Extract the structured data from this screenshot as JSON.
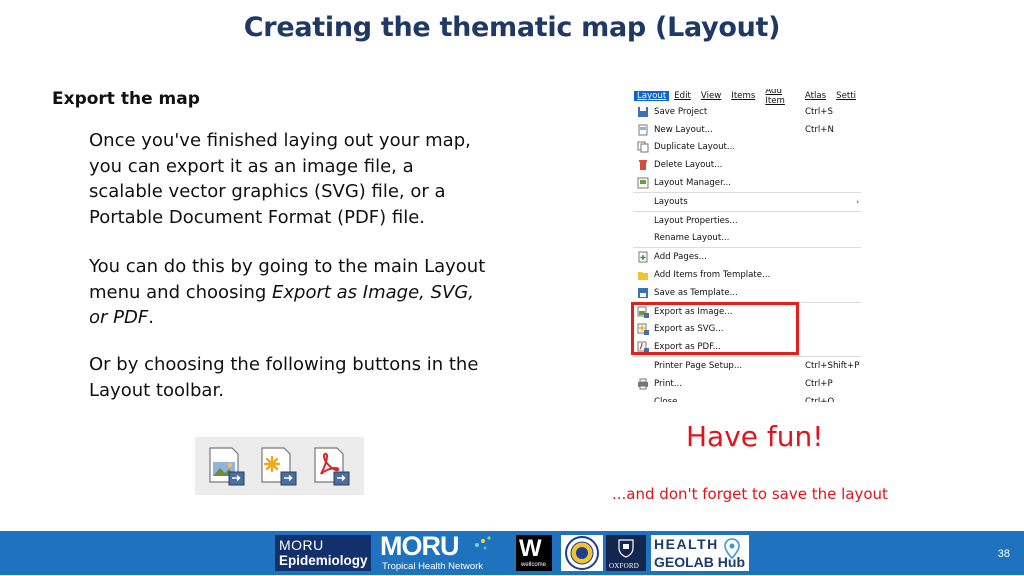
{
  "slide": {
    "title": "Creating the thematic map (Layout)",
    "heading": "Export the map",
    "para1": "Once you've finished laying out your map, you can export it as an image file, a scalable vector graphics (SVG) file, or a Portable Document Format (PDF) file.",
    "para2_start": "You can do this by going to the main Layout menu and choosing ",
    "para2_italic": "Export as Image, SVG, or PDF",
    "para2_end": ".",
    "para3": "Or by choosing the following buttons in the Layout toolbar.",
    "have_fun": "Have fun!",
    "save_reminder": "...and don't forget to save the layout",
    "page_number": "38"
  },
  "menu": {
    "bar": [
      "Layout",
      "Edit",
      "View",
      "Items",
      "Add Item",
      "Atlas",
      "Setti"
    ],
    "items": [
      {
        "label": "Save Project",
        "shortcut": "Ctrl+S",
        "icon": "save-icon"
      },
      {
        "label": "New Layout...",
        "shortcut": "Ctrl+N",
        "icon": "new-layout-icon"
      },
      {
        "label": "Duplicate Layout...",
        "shortcut": "",
        "icon": "duplicate-icon"
      },
      {
        "label": "Delete Layout...",
        "shortcut": "",
        "icon": "delete-icon"
      },
      {
        "label": "Layout Manager...",
        "shortcut": "",
        "icon": "layout-manager-icon"
      },
      {
        "label": "Layouts",
        "shortcut": "",
        "icon": "",
        "submenu": true
      },
      {
        "label": "Layout Properties...",
        "shortcut": "",
        "icon": ""
      },
      {
        "label": "Rename Layout...",
        "shortcut": "",
        "icon": ""
      },
      {
        "label": "Add Pages...",
        "shortcut": "",
        "icon": "add-pages-icon"
      },
      {
        "label": "Add Items from Template...",
        "shortcut": "",
        "icon": "folder-icon"
      },
      {
        "label": "Save as Template...",
        "shortcut": "",
        "icon": "save-template-icon"
      },
      {
        "label": "Export as Image...",
        "shortcut": "",
        "icon": "export-image-icon"
      },
      {
        "label": "Export as SVG...",
        "shortcut": "",
        "icon": "export-svg-icon"
      },
      {
        "label": "Export as PDF...",
        "shortcut": "",
        "icon": "export-pdf-icon"
      },
      {
        "label": "Printer Page Setup...",
        "shortcut": "Ctrl+Shift+P",
        "icon": ""
      },
      {
        "label": "Print...",
        "shortcut": "Ctrl+P",
        "icon": "print-icon"
      },
      {
        "label": "Close",
        "shortcut": "Ctrl+Q",
        "icon": ""
      }
    ]
  },
  "toolbar": {
    "buttons": [
      "export-image-icon",
      "export-svg-icon",
      "export-pdf-icon"
    ]
  },
  "footer": {
    "logos": {
      "moru_epi_line1": "MORU",
      "moru_epi_line2": "Epidemiology",
      "moru_trop_line1": "MORU",
      "moru_trop_line2": "Tropical Health Network",
      "wellcome_mark": "W",
      "wellcome_text": "wellcome",
      "oxford_text": "OXFORD",
      "health_line1": "HEALTH",
      "health_line2": "GEOLAB Hub"
    }
  },
  "colors": {
    "title": "#1f3864",
    "accent_red": "#e3131c",
    "footer_bg": "#1f72bd",
    "menu_highlight": "#0a64d0"
  }
}
